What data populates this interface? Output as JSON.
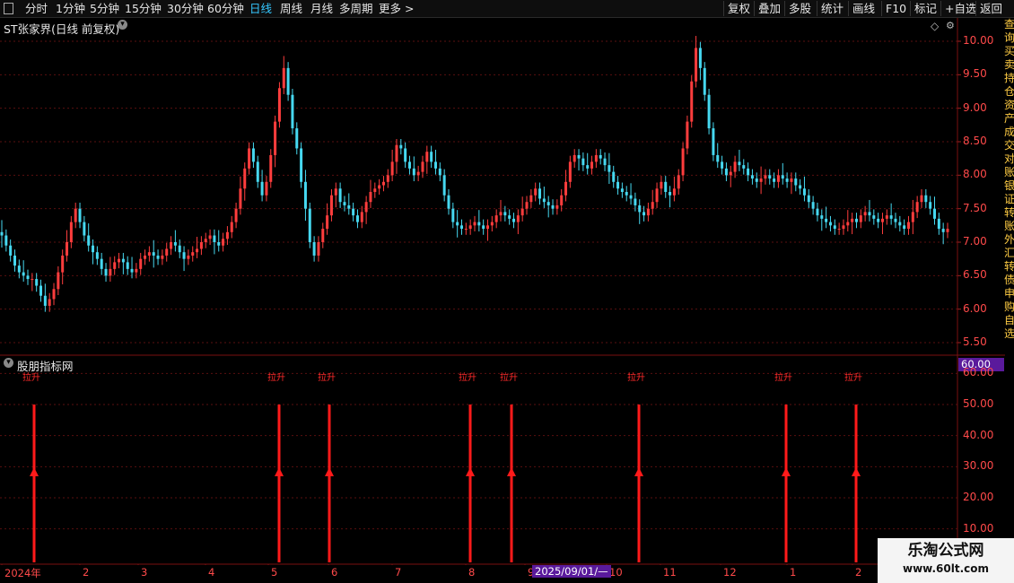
{
  "toolbar": {
    "periods": [
      "分时",
      "1分钟",
      "5分钟",
      "15分钟",
      "30分钟",
      "60分钟",
      "日线",
      "周线",
      "月线",
      "多周期",
      "更多 >"
    ],
    "active": "日线",
    "right": [
      "复权",
      "叠加",
      "多股",
      "统计",
      "画线",
      "F10",
      "标记",
      "+自选",
      "返回"
    ]
  },
  "main": {
    "title": "ST张家界(日线 前复权)",
    "price_ticks": [
      "10.00",
      "9.50",
      "9.00",
      "8.50",
      "8.00",
      "7.50",
      "7.00",
      "6.50",
      "6.00",
      "5.50"
    ]
  },
  "indicator": {
    "title": "股朋指标网",
    "badge": "60.00",
    "ticks": [
      "60.00",
      "50.00",
      "40.00",
      "30.00",
      "20.00",
      "10.00"
    ],
    "signal_label": "拉升",
    "signal_count": 8
  },
  "xaxis": {
    "labels": [
      "2024年",
      "2",
      "3",
      "4",
      "5",
      "6",
      "7",
      "8",
      "9",
      "10",
      "11",
      "12",
      "1",
      "2"
    ],
    "cursor_date": "2025/09/01/—"
  },
  "watermark": {
    "title": "乐淘公式网",
    "url": "www.60lt.com"
  },
  "right_strip_text": "查询买卖持仓资产成交对账银证转账外汇转债申购自选",
  "colors": {
    "up": "#ff3d3d",
    "down": "#46d8f0",
    "grid": "#5a0f0f",
    "signal": "#ff1a1a",
    "accent": "#35c7ff"
  },
  "chart_data": {
    "type": "candlestick",
    "ylim": [
      5.35,
      10.15
    ],
    "closes": [
      7.1,
      6.95,
      6.8,
      6.65,
      6.55,
      6.5,
      6.45,
      6.45,
      6.35,
      6.2,
      6.05,
      6.15,
      6.3,
      6.55,
      6.8,
      7.0,
      7.3,
      7.5,
      7.3,
      7.1,
      6.95,
      6.85,
      6.75,
      6.6,
      6.5,
      6.6,
      6.7,
      6.75,
      6.7,
      6.6,
      6.55,
      6.6,
      6.75,
      6.8,
      6.85,
      6.8,
      6.75,
      6.8,
      6.9,
      7.0,
      6.95,
      6.85,
      6.75,
      6.8,
      6.85,
      6.9,
      7.0,
      7.05,
      7.1,
      7.0,
      6.95,
      7.05,
      7.15,
      7.3,
      7.5,
      7.8,
      8.1,
      8.4,
      8.2,
      7.9,
      7.7,
      7.9,
      8.3,
      8.8,
      9.3,
      9.6,
      9.2,
      8.7,
      8.4,
      7.9,
      7.5,
      7.0,
      6.8,
      7.0,
      7.2,
      7.4,
      7.7,
      7.8,
      7.6,
      7.55,
      7.5,
      7.4,
      7.3,
      7.45,
      7.6,
      7.75,
      7.8,
      7.85,
      7.9,
      8.0,
      8.2,
      8.45,
      8.4,
      8.2,
      8.1,
      8.0,
      8.05,
      8.2,
      8.35,
      8.2,
      8.1,
      8.0,
      7.7,
      7.5,
      7.3,
      7.25,
      7.2,
      7.2,
      7.25,
      7.3,
      7.25,
      7.2,
      7.25,
      7.3,
      7.4,
      7.45,
      7.4,
      7.35,
      7.3,
      7.4,
      7.5,
      7.6,
      7.7,
      7.8,
      7.65,
      7.6,
      7.55,
      7.5,
      7.55,
      7.7,
      7.9,
      8.2,
      8.3,
      8.25,
      8.15,
      8.1,
      8.2,
      8.3,
      8.25,
      8.15,
      8.05,
      7.9,
      7.8,
      7.75,
      7.7,
      7.65,
      7.55,
      7.45,
      7.4,
      7.5,
      7.6,
      7.8,
      7.9,
      7.75,
      7.7,
      7.8,
      8.0,
      8.4,
      8.8,
      9.4,
      9.9,
      9.6,
      9.2,
      8.7,
      8.3,
      8.2,
      8.1,
      8.0,
      8.05,
      8.2,
      8.15,
      8.1,
      8.0,
      7.95,
      7.9,
      7.95,
      8.0,
      7.95,
      7.9,
      8.0,
      7.95,
      7.9,
      7.95,
      7.85,
      7.8,
      7.7,
      7.6,
      7.5,
      7.4,
      7.35,
      7.3,
      7.25,
      7.2,
      7.2,
      7.25,
      7.3,
      7.35,
      7.3,
      7.4,
      7.45,
      7.4,
      7.35,
      7.3,
      7.35,
      7.4,
      7.35,
      7.3,
      7.25,
      7.2,
      7.3,
      7.45,
      7.6,
      7.7,
      7.6,
      7.5,
      7.35,
      7.2,
      7.15,
      7.2
    ]
  }
}
